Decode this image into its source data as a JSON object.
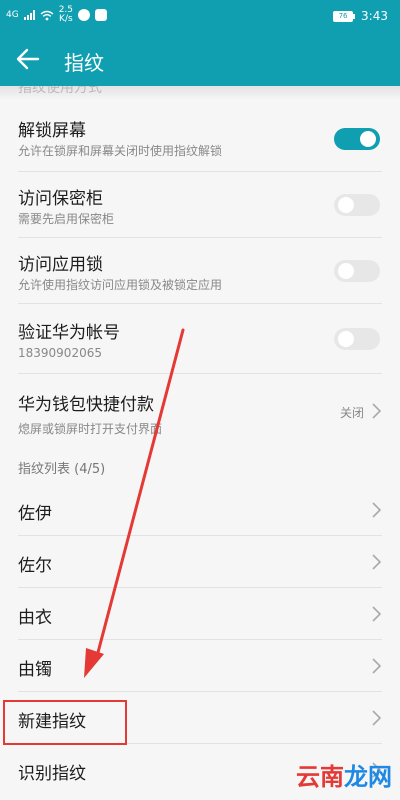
{
  "status_bar": {
    "network": "4G",
    "speed_value": "2.5",
    "speed_unit": "K/s",
    "battery": "76",
    "time": "3:43"
  },
  "header": {
    "title": "指纹",
    "back_icon": "arrow-left-icon"
  },
  "settings": {
    "partial_row": "指纹使用方式",
    "unlock_screen": {
      "title": "解锁屏幕",
      "subtitle": "允许在锁屏和屏幕关闭时使用指纹解锁",
      "toggle": "on"
    },
    "safe_box": {
      "title": "访问保密柜",
      "subtitle": "需要先启用保密柜",
      "toggle": "off"
    },
    "app_lock": {
      "title": "访问应用锁",
      "subtitle": "允许使用指纹访问应用锁及被锁定应用",
      "toggle": "off"
    },
    "huawei_account": {
      "title": "验证华为帐号",
      "subtitle": "18390902065",
      "toggle": "off"
    },
    "wallet": {
      "title": "华为钱包快捷付款",
      "subtitle": "熄屏或锁屏时打开支付界面",
      "value": "关闭"
    }
  },
  "fingerprint_list": {
    "header": "指纹列表 (4/5)",
    "items": [
      "佐伊",
      "佐尔",
      "由衣",
      "由镯"
    ],
    "new_fingerprint": "新建指纹",
    "identify": "识别指纹"
  },
  "watermark": {
    "part1": "云南",
    "part2": "龙网"
  },
  "colors": {
    "accent": "#0f9fb1",
    "annotation": "#e53935"
  }
}
